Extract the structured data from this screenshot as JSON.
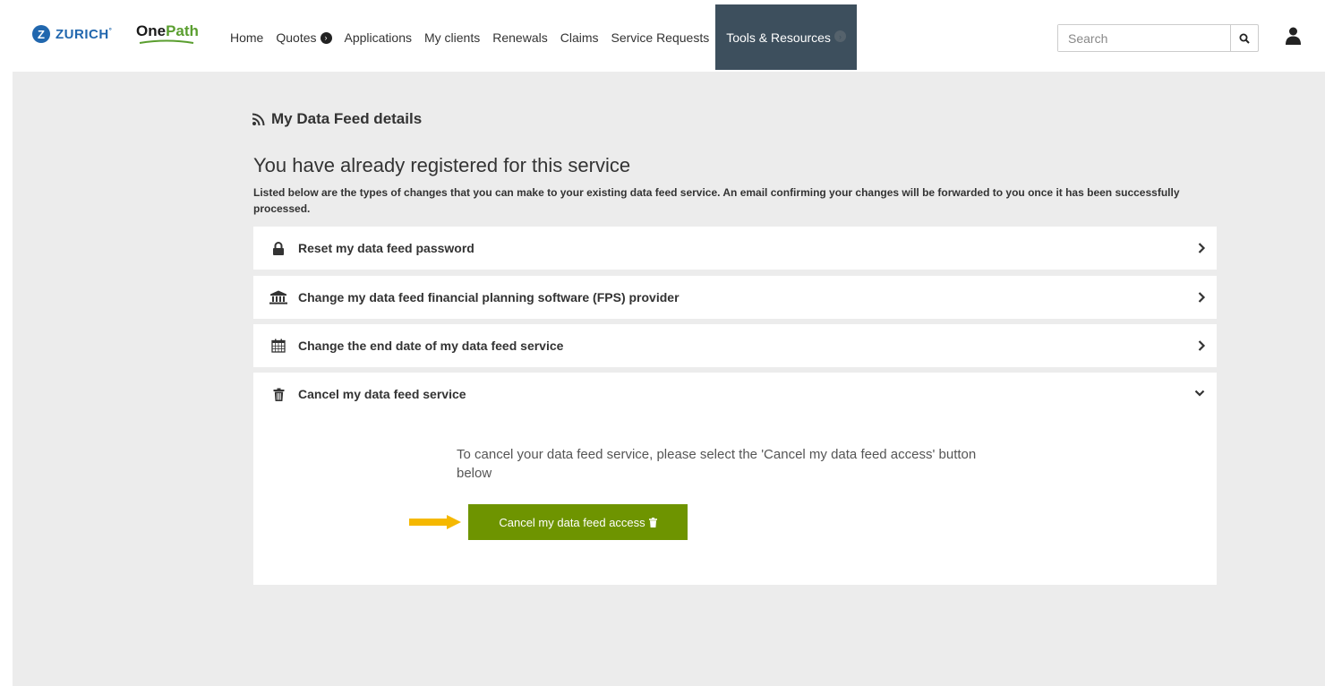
{
  "brand": {
    "zurich_initial": "Z",
    "zurich": "ZURICH",
    "onepath_one": "One",
    "onepath_path": "Path"
  },
  "nav": {
    "items": [
      {
        "label": "Home"
      },
      {
        "label": "Quotes"
      },
      {
        "label": "Applications"
      },
      {
        "label": "My clients"
      },
      {
        "label": "Renewals"
      },
      {
        "label": "Claims"
      },
      {
        "label": "Service Requests"
      },
      {
        "label": "Tools & Resources"
      }
    ],
    "active_index": 7,
    "active_color": "#3d4f5d"
  },
  "search": {
    "placeholder": "Search"
  },
  "page": {
    "title": "My Data Feed details",
    "subtitle": "You have already registered for this service",
    "intro": "Listed below are the types of changes that you can make to your existing data feed service. An email confirming your changes will be forwarded to you once it has been successfully processed."
  },
  "accordion": [
    {
      "label": "Reset my data feed password",
      "icon": "lock-icon",
      "expanded": false
    },
    {
      "label": "Change my data feed financial planning software (FPS) provider",
      "icon": "bank-icon",
      "expanded": false
    },
    {
      "label": "Change the end date of my data feed service",
      "icon": "calendar-icon",
      "expanded": false
    },
    {
      "label": "Cancel my data feed service",
      "icon": "trash-icon",
      "expanded": true
    }
  ],
  "cancel_panel": {
    "text": "To cancel your data feed service, please select the 'Cancel my data feed access' button below",
    "button_label": "Cancel my data feed access"
  },
  "colors": {
    "button_green": "#6e9400",
    "arrow_yellow": "#f5b800",
    "zurich_blue": "#2167ae",
    "onepath_green": "#5a9e2f"
  }
}
